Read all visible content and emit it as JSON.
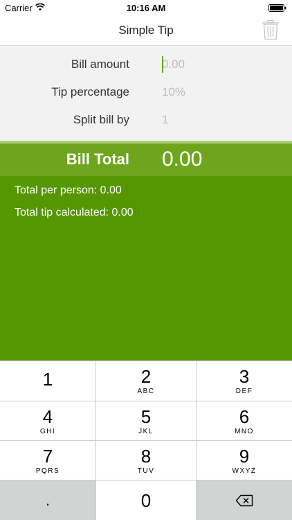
{
  "status_bar": {
    "carrier": "Carrier",
    "time": "10:16 AM"
  },
  "nav": {
    "title": "Simple Tip",
    "trash_icon": "trash-icon"
  },
  "form": {
    "bill_amount_label": "Bill amount",
    "bill_amount_placeholder": "0.00",
    "tip_percentage_label": "Tip percentage",
    "tip_percentage_placeholder": "10%",
    "split_label": "Split bill by",
    "split_placeholder": "1"
  },
  "total": {
    "label": "Bill Total",
    "value": "0.00"
  },
  "results": {
    "per_person_label": "Total per person:",
    "per_person_value": "0.00",
    "tip_label": "Total tip calculated:",
    "tip_value": "0.00"
  },
  "keypad": {
    "keys": [
      {
        "digit": "1",
        "letters": ""
      },
      {
        "digit": "2",
        "letters": "ABC"
      },
      {
        "digit": "3",
        "letters": "DEF"
      },
      {
        "digit": "4",
        "letters": "GHI"
      },
      {
        "digit": "5",
        "letters": "JKL"
      },
      {
        "digit": "6",
        "letters": "MNO"
      },
      {
        "digit": "7",
        "letters": "PQRS"
      },
      {
        "digit": "8",
        "letters": "TUV"
      },
      {
        "digit": "9",
        "letters": "WXYZ"
      }
    ],
    "dot": ".",
    "zero": "0",
    "backspace_icon": "backspace-icon"
  },
  "colors": {
    "total_bar": "#6fa51d",
    "results_bg": "#549703",
    "form_bg": "#f2f2f2"
  }
}
